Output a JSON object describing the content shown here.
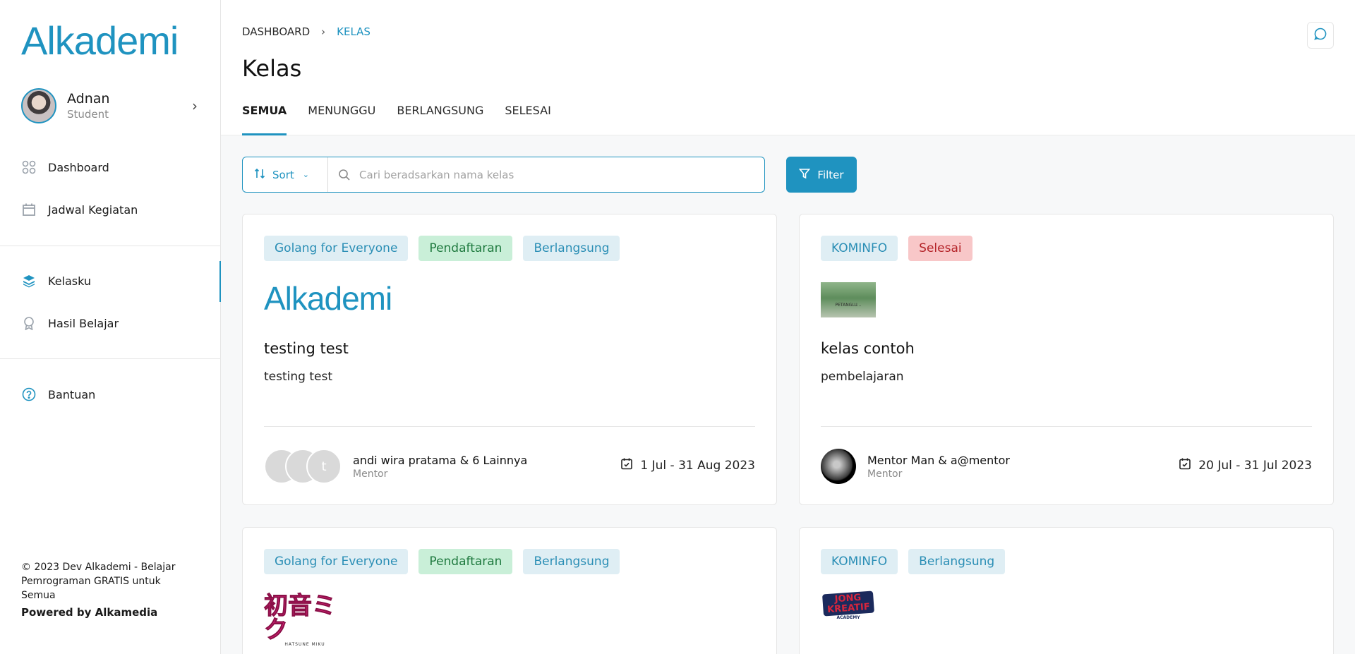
{
  "app": {
    "logo_text": "Alkademi"
  },
  "profile": {
    "name": "Adnan",
    "role": "Student"
  },
  "sidebar": {
    "items": [
      {
        "label": "Dashboard",
        "icon": "grid-icon"
      },
      {
        "label": "Jadwal Kegiatan",
        "icon": "calendar-icon"
      },
      {
        "label": "Kelasku",
        "icon": "layers-icon",
        "active": true
      },
      {
        "label": "Hasil Belajar",
        "icon": "award-icon"
      },
      {
        "label": "Bantuan",
        "icon": "help-circle-icon"
      }
    ],
    "footer_text": "© 2023 Dev Alkademi - Belajar Pemrograman GRATIS untuk Semua",
    "powered_by": "Powered by Alkamedia"
  },
  "breadcrumb": {
    "items": [
      "DASHBOARD",
      "KELAS"
    ]
  },
  "page": {
    "title": "Kelas"
  },
  "tabs": [
    "SEMUA",
    "MENUNGGU",
    "BERLANGSUNG",
    "SELESAI"
  ],
  "toolbar": {
    "sort_label": "Sort",
    "search_placeholder": "Cari beradsarkan nama kelas",
    "filter_label": "Filter"
  },
  "cards": [
    {
      "tags": [
        "Golang for Everyone",
        "Pendaftaran",
        "Berlangsung"
      ],
      "logo": "Alkademi",
      "title": "testing test",
      "description": "testing test",
      "mentor": "andi wira pratama & 6 Lainnya",
      "mentor_role": "Mentor",
      "avatar_initial": "t",
      "date": "1 Jul - 31 Aug 2023"
    },
    {
      "tags": [
        "KOMINFO",
        "Selesai"
      ],
      "logo_caption": "PETANGLU...",
      "title": "kelas contoh",
      "description": "pembelajaran",
      "mentor": "Mentor Man & a@mentor",
      "mentor_role": "Mentor",
      "date": "20 Jul - 31 Jul 2023"
    },
    {
      "tags": [
        "Golang for Everyone",
        "Pendaftaran",
        "Berlangsung"
      ],
      "logo": "初音ミク",
      "logo_caption": "HATSUNE MIKU"
    },
    {
      "tags": [
        "KOMINFO",
        "Berlangsung"
      ],
      "logo": "JONG KREATIF",
      "logo_caption": "ACADEMY"
    }
  ],
  "colors": {
    "accent": "#1f93c0",
    "tag_blue_bg": "#dfeef4",
    "tag_green_bg": "#c9efd8",
    "tag_red_bg": "#f8c7c8"
  }
}
